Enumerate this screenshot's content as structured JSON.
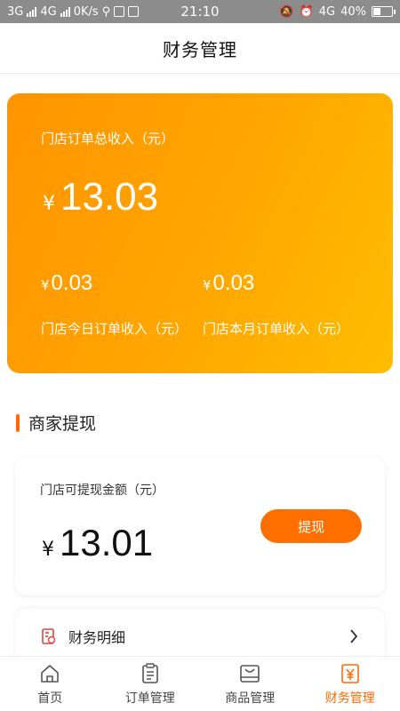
{
  "status_bar": {
    "network1": "3G",
    "network2": "4G",
    "speed": "0K/s",
    "time": "21:10",
    "network3": "4G",
    "battery": "40%",
    "battery_level": 0.4
  },
  "header": {
    "title": "财务管理"
  },
  "summary": {
    "total_label": "门店订单总收入（元）",
    "currency": "¥",
    "total_value": "13.03",
    "today_value": "0.03",
    "today_label": "门店今日订单收入（元）",
    "month_value": "0.03",
    "month_label": "门店本月订单收入（元）"
  },
  "withdraw_section": {
    "title": "商家提现",
    "label": "门店可提现金额（元）",
    "currency": "¥",
    "amount": "13.01",
    "button": "提现"
  },
  "detail": {
    "label": "财务明细",
    "icon": "ledger-icon"
  },
  "tabbar": {
    "items": [
      {
        "label": "首页",
        "icon": "home-icon",
        "active": false
      },
      {
        "label": "订单管理",
        "icon": "order-icon",
        "active": false
      },
      {
        "label": "商品管理",
        "icon": "product-icon",
        "active": false
      },
      {
        "label": "财务管理",
        "icon": "finance-icon",
        "active": true
      }
    ]
  },
  "colors": {
    "accent": "#ff6a00",
    "card_start": "#ff9400",
    "card_end": "#ffbd00"
  }
}
